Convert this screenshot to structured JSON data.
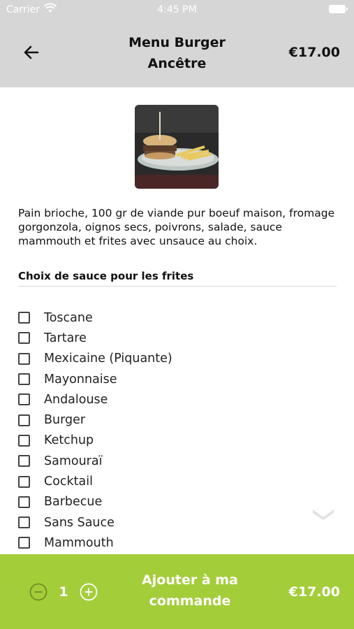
{
  "status_bar": {
    "carrier": "Carrier",
    "time": "4:45 PM"
  },
  "header": {
    "title": "Menu Burger Ancêtre",
    "price": "€17.00",
    "back_icon": "arrow-left-icon"
  },
  "product": {
    "description": "Pain brioche, 100 gr de viande pur boeuf maison, fromage gorgonzola, oignos secs, poivrons, salade, sauce mammouth et frites avec unsauce au choix."
  },
  "sauce_section": {
    "title": "Choix de sauce pour les frites",
    "options": [
      {
        "label": "Toscane",
        "checked": false
      },
      {
        "label": "Tartare",
        "checked": false
      },
      {
        "label": "Mexicaine (Piquante)",
        "checked": false
      },
      {
        "label": "Mayonnaise",
        "checked": false
      },
      {
        "label": "Andalouse",
        "checked": false
      },
      {
        "label": "Burger",
        "checked": false
      },
      {
        "label": "Ketchup",
        "checked": false
      },
      {
        "label": "Samouraï",
        "checked": false
      },
      {
        "label": "Cocktail",
        "checked": false
      },
      {
        "label": "Barbecue",
        "checked": false
      },
      {
        "label": "Sans Sauce",
        "checked": false
      },
      {
        "label": "Mammouth",
        "checked": false
      }
    ]
  },
  "footer": {
    "quantity": "1",
    "add_label": "Ajouter à ma commande",
    "price": "€17.00"
  },
  "colors": {
    "header_bg": "#d6d6d6",
    "footer_bg": "#a4cd3a"
  }
}
